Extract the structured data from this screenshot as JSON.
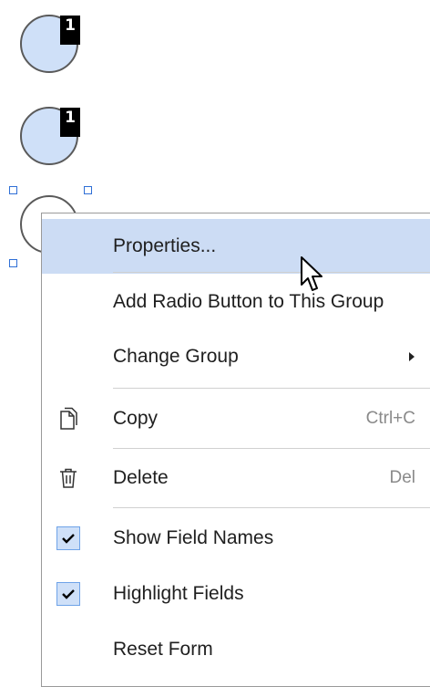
{
  "badges": {
    "first": "1",
    "second": "1"
  },
  "context_menu": {
    "items": [
      {
        "label": "Properties...",
        "shortcut": "",
        "icon": "",
        "highlighted": true
      },
      {
        "label": "Add Radio Button to This Group",
        "shortcut": "",
        "icon": ""
      },
      {
        "label": "Change Group",
        "shortcut": "",
        "icon": "chevron-right-icon",
        "has_submenu": true
      },
      {
        "label": "Copy",
        "shortcut": "Ctrl+C",
        "icon": "copy-icon"
      },
      {
        "label": "Delete",
        "shortcut": "Del",
        "icon": "trash-icon"
      },
      {
        "label": "Show Field Names",
        "shortcut": "",
        "icon": "check-icon",
        "checked": true
      },
      {
        "label": "Highlight Fields",
        "shortcut": "",
        "icon": "check-icon",
        "checked": true
      },
      {
        "label": "Reset Form",
        "shortcut": "",
        "icon": ""
      }
    ]
  },
  "colors": {
    "highlight": "#ccdcf4",
    "radio_fill": "#cfe0f8",
    "selection_handle": "#2f6fd6"
  }
}
